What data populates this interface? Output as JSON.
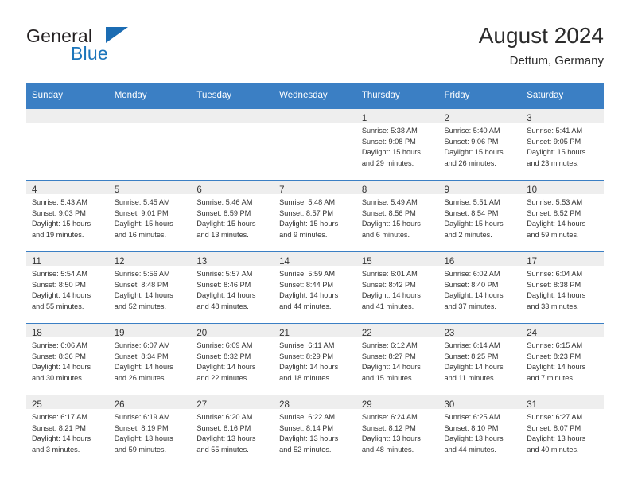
{
  "logo": {
    "word_one": "General",
    "word_two": "Blue",
    "mark": "triangle-flag-icon"
  },
  "header": {
    "title": "August 2024",
    "subtitle": "Dettum, Germany"
  },
  "calendar": {
    "weekday_headers": [
      "Sunday",
      "Monday",
      "Tuesday",
      "Wednesday",
      "Thursday",
      "Friday",
      "Saturday"
    ],
    "accent_color": "#3b7fc4",
    "band_color": "#eeeeee",
    "weeks": [
      [
        {
          "day": "",
          "empty": true
        },
        {
          "day": "",
          "empty": true
        },
        {
          "day": "",
          "empty": true
        },
        {
          "day": "",
          "empty": true
        },
        {
          "day": "1",
          "sunrise": "Sunrise: 5:38 AM",
          "sunset": "Sunset: 9:08 PM",
          "daylight_line1": "Daylight: 15 hours",
          "daylight_line2": "and 29 minutes."
        },
        {
          "day": "2",
          "sunrise": "Sunrise: 5:40 AM",
          "sunset": "Sunset: 9:06 PM",
          "daylight_line1": "Daylight: 15 hours",
          "daylight_line2": "and 26 minutes."
        },
        {
          "day": "3",
          "sunrise": "Sunrise: 5:41 AM",
          "sunset": "Sunset: 9:05 PM",
          "daylight_line1": "Daylight: 15 hours",
          "daylight_line2": "and 23 minutes."
        }
      ],
      [
        {
          "day": "4",
          "sunrise": "Sunrise: 5:43 AM",
          "sunset": "Sunset: 9:03 PM",
          "daylight_line1": "Daylight: 15 hours",
          "daylight_line2": "and 19 minutes."
        },
        {
          "day": "5",
          "sunrise": "Sunrise: 5:45 AM",
          "sunset": "Sunset: 9:01 PM",
          "daylight_line1": "Daylight: 15 hours",
          "daylight_line2": "and 16 minutes."
        },
        {
          "day": "6",
          "sunrise": "Sunrise: 5:46 AM",
          "sunset": "Sunset: 8:59 PM",
          "daylight_line1": "Daylight: 15 hours",
          "daylight_line2": "and 13 minutes."
        },
        {
          "day": "7",
          "sunrise": "Sunrise: 5:48 AM",
          "sunset": "Sunset: 8:57 PM",
          "daylight_line1": "Daylight: 15 hours",
          "daylight_line2": "and 9 minutes."
        },
        {
          "day": "8",
          "sunrise": "Sunrise: 5:49 AM",
          "sunset": "Sunset: 8:56 PM",
          "daylight_line1": "Daylight: 15 hours",
          "daylight_line2": "and 6 minutes."
        },
        {
          "day": "9",
          "sunrise": "Sunrise: 5:51 AM",
          "sunset": "Sunset: 8:54 PM",
          "daylight_line1": "Daylight: 15 hours",
          "daylight_line2": "and 2 minutes."
        },
        {
          "day": "10",
          "sunrise": "Sunrise: 5:53 AM",
          "sunset": "Sunset: 8:52 PM",
          "daylight_line1": "Daylight: 14 hours",
          "daylight_line2": "and 59 minutes."
        }
      ],
      [
        {
          "day": "11",
          "sunrise": "Sunrise: 5:54 AM",
          "sunset": "Sunset: 8:50 PM",
          "daylight_line1": "Daylight: 14 hours",
          "daylight_line2": "and 55 minutes."
        },
        {
          "day": "12",
          "sunrise": "Sunrise: 5:56 AM",
          "sunset": "Sunset: 8:48 PM",
          "daylight_line1": "Daylight: 14 hours",
          "daylight_line2": "and 52 minutes."
        },
        {
          "day": "13",
          "sunrise": "Sunrise: 5:57 AM",
          "sunset": "Sunset: 8:46 PM",
          "daylight_line1": "Daylight: 14 hours",
          "daylight_line2": "and 48 minutes."
        },
        {
          "day": "14",
          "sunrise": "Sunrise: 5:59 AM",
          "sunset": "Sunset: 8:44 PM",
          "daylight_line1": "Daylight: 14 hours",
          "daylight_line2": "and 44 minutes."
        },
        {
          "day": "15",
          "sunrise": "Sunrise: 6:01 AM",
          "sunset": "Sunset: 8:42 PM",
          "daylight_line1": "Daylight: 14 hours",
          "daylight_line2": "and 41 minutes."
        },
        {
          "day": "16",
          "sunrise": "Sunrise: 6:02 AM",
          "sunset": "Sunset: 8:40 PM",
          "daylight_line1": "Daylight: 14 hours",
          "daylight_line2": "and 37 minutes."
        },
        {
          "day": "17",
          "sunrise": "Sunrise: 6:04 AM",
          "sunset": "Sunset: 8:38 PM",
          "daylight_line1": "Daylight: 14 hours",
          "daylight_line2": "and 33 minutes."
        }
      ],
      [
        {
          "day": "18",
          "sunrise": "Sunrise: 6:06 AM",
          "sunset": "Sunset: 8:36 PM",
          "daylight_line1": "Daylight: 14 hours",
          "daylight_line2": "and 30 minutes."
        },
        {
          "day": "19",
          "sunrise": "Sunrise: 6:07 AM",
          "sunset": "Sunset: 8:34 PM",
          "daylight_line1": "Daylight: 14 hours",
          "daylight_line2": "and 26 minutes."
        },
        {
          "day": "20",
          "sunrise": "Sunrise: 6:09 AM",
          "sunset": "Sunset: 8:32 PM",
          "daylight_line1": "Daylight: 14 hours",
          "daylight_line2": "and 22 minutes."
        },
        {
          "day": "21",
          "sunrise": "Sunrise: 6:11 AM",
          "sunset": "Sunset: 8:29 PM",
          "daylight_line1": "Daylight: 14 hours",
          "daylight_line2": "and 18 minutes."
        },
        {
          "day": "22",
          "sunrise": "Sunrise: 6:12 AM",
          "sunset": "Sunset: 8:27 PM",
          "daylight_line1": "Daylight: 14 hours",
          "daylight_line2": "and 15 minutes."
        },
        {
          "day": "23",
          "sunrise": "Sunrise: 6:14 AM",
          "sunset": "Sunset: 8:25 PM",
          "daylight_line1": "Daylight: 14 hours",
          "daylight_line2": "and 11 minutes."
        },
        {
          "day": "24",
          "sunrise": "Sunrise: 6:15 AM",
          "sunset": "Sunset: 8:23 PM",
          "daylight_line1": "Daylight: 14 hours",
          "daylight_line2": "and 7 minutes."
        }
      ],
      [
        {
          "day": "25",
          "sunrise": "Sunrise: 6:17 AM",
          "sunset": "Sunset: 8:21 PM",
          "daylight_line1": "Daylight: 14 hours",
          "daylight_line2": "and 3 minutes."
        },
        {
          "day": "26",
          "sunrise": "Sunrise: 6:19 AM",
          "sunset": "Sunset: 8:19 PM",
          "daylight_line1": "Daylight: 13 hours",
          "daylight_line2": "and 59 minutes."
        },
        {
          "day": "27",
          "sunrise": "Sunrise: 6:20 AM",
          "sunset": "Sunset: 8:16 PM",
          "daylight_line1": "Daylight: 13 hours",
          "daylight_line2": "and 55 minutes."
        },
        {
          "day": "28",
          "sunrise": "Sunrise: 6:22 AM",
          "sunset": "Sunset: 8:14 PM",
          "daylight_line1": "Daylight: 13 hours",
          "daylight_line2": "and 52 minutes."
        },
        {
          "day": "29",
          "sunrise": "Sunrise: 6:24 AM",
          "sunset": "Sunset: 8:12 PM",
          "daylight_line1": "Daylight: 13 hours",
          "daylight_line2": "and 48 minutes."
        },
        {
          "day": "30",
          "sunrise": "Sunrise: 6:25 AM",
          "sunset": "Sunset: 8:10 PM",
          "daylight_line1": "Daylight: 13 hours",
          "daylight_line2": "and 44 minutes."
        },
        {
          "day": "31",
          "sunrise": "Sunrise: 6:27 AM",
          "sunset": "Sunset: 8:07 PM",
          "daylight_line1": "Daylight: 13 hours",
          "daylight_line2": "and 40 minutes."
        }
      ]
    ]
  }
}
